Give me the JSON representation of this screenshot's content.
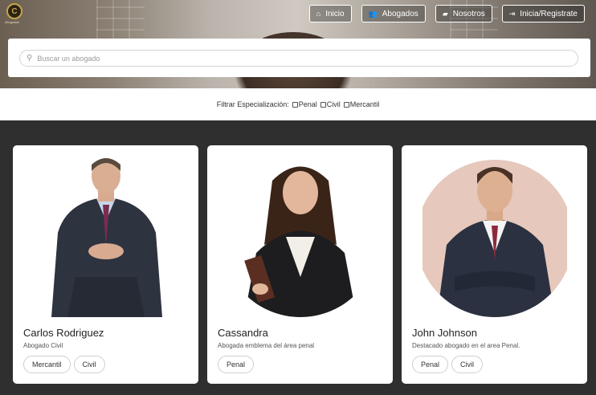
{
  "brand": {
    "logo_letter": "C",
    "caption": "Abogados"
  },
  "nav": [
    {
      "icon": "home-icon",
      "glyph": "⌂",
      "label": "Inicio"
    },
    {
      "icon": "users-icon",
      "glyph": "👥",
      "label": "Abogados"
    },
    {
      "icon": "book-icon",
      "glyph": "▰",
      "label": "Nosotros"
    },
    {
      "icon": "sign-in-icon",
      "glyph": "⇥",
      "label": "Inicia/Registrate"
    }
  ],
  "search": {
    "placeholder": "Buscar un abogado"
  },
  "filter": {
    "label": "Filtrar Especialización:",
    "options": [
      "Penal",
      "Civil",
      "Mercantil"
    ]
  },
  "lawyers": [
    {
      "name": "Carlos Rodriguez",
      "description": "Abogado Civil",
      "tags": [
        "Mercantil",
        "Civil"
      ]
    },
    {
      "name": "Cassandra",
      "description": "Abogada emblema del área penal",
      "tags": [
        "Penal"
      ]
    },
    {
      "name": "John Johnson",
      "description": "Destacado abogado en el area Penal.",
      "tags": [
        "Penal",
        "Civil"
      ]
    }
  ],
  "colors": {
    "background": "#2f2f30",
    "card": "#ffffff",
    "accent_gold": "#c8a44a"
  }
}
